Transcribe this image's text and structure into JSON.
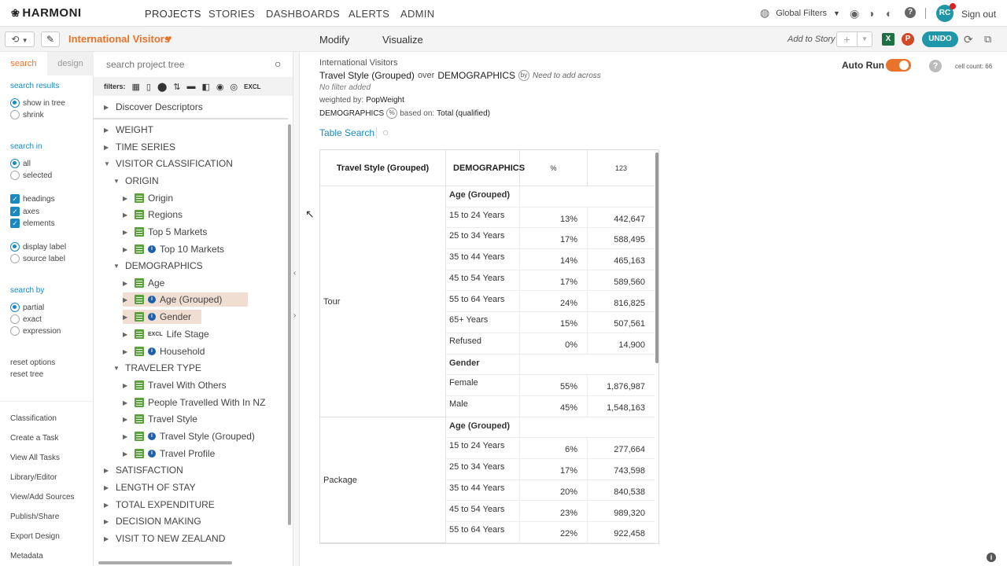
{
  "app": {
    "brand": "HARMONI"
  },
  "nav": {
    "items": [
      "PROJECTS",
      "STORIES",
      "DASHBOARDS",
      "ALERTS",
      "ADMIN"
    ],
    "active": "PROJECTS"
  },
  "topbar_right": {
    "global_filters": "Global Filters",
    "avatar": "RC",
    "signout": "Sign out"
  },
  "project": {
    "title": "International Visitors"
  },
  "modes": {
    "modify": "Modify",
    "visualize": "Visualize",
    "add_to_story": "Add to Story",
    "undo": "UNDO"
  },
  "left": {
    "tabs": {
      "search": "search",
      "design": "design"
    },
    "search_results": "search results",
    "show_in_tree": "show in tree",
    "shrink": "shrink",
    "search_in": "search in",
    "all": "all",
    "selected": "selected",
    "headings": "headings",
    "axes": "axes",
    "elements": "elements",
    "display_label": "display label",
    "source_label": "source label",
    "search_by": "search by",
    "partial": "partial",
    "exact": "exact",
    "expression": "expression",
    "reset_options": "reset options",
    "reset_tree": "reset tree",
    "links": [
      "Classification",
      "Create a Task",
      "View All Tasks",
      "Library/Editor",
      "View/Add Sources",
      "Publish/Share",
      "Export Design",
      "Metadata"
    ]
  },
  "tree": {
    "search_placeholder": "search project tree",
    "filters_label": "filters:",
    "excl": "EXCL",
    "discover": "Discover Descriptors",
    "nodes": {
      "weight": "WEIGHT",
      "time_series": "TIME SERIES",
      "visitor_classification": "VISITOR CLASSIFICATION",
      "origin_group": "ORIGIN",
      "origin": "Origin",
      "regions": "Regions",
      "top5": "Top 5 Markets",
      "top10": "Top 10 Markets",
      "demographics": "DEMOGRAPHICS",
      "age": "Age",
      "age_grouped": "Age (Grouped)",
      "gender": "Gender",
      "life_stage": "Life Stage",
      "household": "Household",
      "traveler_type": "TRAVELER TYPE",
      "travel_with": "Travel With Others",
      "people_travelled": "People Travelled With In NZ",
      "travel_style": "Travel Style",
      "travel_style_grouped": "Travel Style (Grouped)",
      "travel_profile": "Travel Profile",
      "satisfaction": "SATISFACTION",
      "length_of_stay": "LENGTH OF STAY",
      "total_expenditure": "TOTAL EXPENDITURE",
      "decision_making": "DECISION MAKING",
      "visit_nz": "VISIT TO NEW ZEALAND"
    }
  },
  "report": {
    "breadcrumb": "International Visitors",
    "row_var": "Travel Style (Grouped)",
    "over": "over",
    "col_var": "DEMOGRAPHICS",
    "by_badge": "by",
    "need_across": "Need to add across",
    "no_filter": "No filter added",
    "weighted_by_label": "weighted by:",
    "weighted_by": "PopWeight",
    "pct_badge": "%",
    "based_on_label": "based on:",
    "based_on": "Total (qualified)",
    "auto_run": "Auto Run",
    "cell_count": "cell count: 66",
    "table_search": "Table Search"
  },
  "table": {
    "headers": [
      "Travel Style (Grouped)",
      "DEMOGRAPHICS",
      "%",
      "123"
    ],
    "groups": [
      {
        "label": "Tour",
        "sections": [
          {
            "title": "Age (Grouped)",
            "rows": [
              [
                "15 to 24 Years",
                "13%",
                "442,647"
              ],
              [
                "25 to 34 Years",
                "17%",
                "588,495"
              ],
              [
                "35 to 44 Years",
                "14%",
                "465,163"
              ],
              [
                "45 to 54 Years",
                "17%",
                "589,560"
              ],
              [
                "55 to 64 Years",
                "24%",
                "816,825"
              ],
              [
                "65+ Years",
                "15%",
                "507,561"
              ],
              [
                "Refused",
                "0%",
                "14,900"
              ]
            ]
          },
          {
            "title": "Gender",
            "rows": [
              [
                "Female",
                "55%",
                "1,876,987"
              ],
              [
                "Male",
                "45%",
                "1,548,163"
              ]
            ]
          }
        ]
      },
      {
        "label": "Package",
        "sections": [
          {
            "title": "Age (Grouped)",
            "rows": [
              [
                "15 to 24 Years",
                "6%",
                "277,664"
              ],
              [
                "25 to 34 Years",
                "17%",
                "743,598"
              ],
              [
                "35 to 44 Years",
                "20%",
                "840,538"
              ],
              [
                "45 to 54 Years",
                "23%",
                "989,320"
              ],
              [
                "55 to 64 Years",
                "22%",
                "922,458"
              ]
            ]
          }
        ]
      }
    ]
  },
  "colors": {
    "accent": "#e8742b",
    "link": "#1a89c2",
    "undo": "#1f97a8",
    "green": "#5aa33b"
  }
}
